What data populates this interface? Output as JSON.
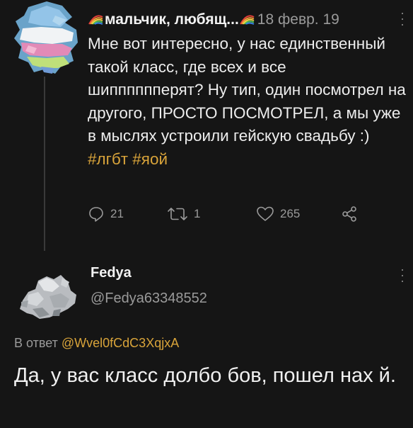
{
  "tweet1": {
    "author_name": "мальчик, любящ...",
    "date": "18 февр. 19",
    "text": "Мне вот интересно, у нас единственный такой класс, где всех и все шипппппперят? Ну тип, один посмотрел на другого, ПРОСТО ПОСМОТРЕЛ, а мы уже в мыслях устроили гейскую свадьбу :)",
    "hashtags": "#лгбт #яой",
    "replies": "21",
    "retweets": "1",
    "likes": "265"
  },
  "tweet2": {
    "author_name": "Fedya",
    "handle": "@Fedya63348552",
    "reply_prefix": "В ответ ",
    "reply_handle": "@Wvel0fCdC3XqjxA",
    "text": "Да, у вас класс долбо бов, пошел нах й."
  },
  "colors": {
    "background": "#151515",
    "accent": "#d9a43a",
    "muted": "#9a9a9a"
  },
  "icons": [
    "rainbow-icon",
    "more-icon",
    "reply-icon",
    "retweet-icon",
    "like-icon",
    "share-icon"
  ]
}
